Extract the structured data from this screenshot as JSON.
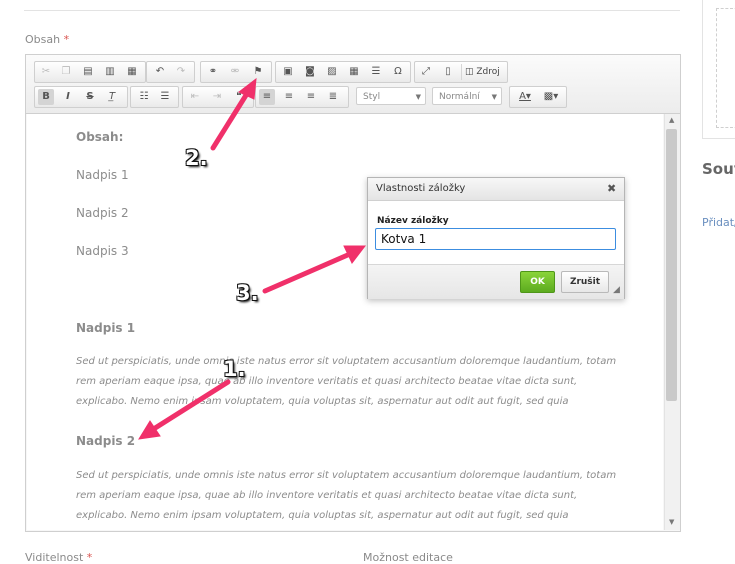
{
  "form": {
    "content_label": "Obsah",
    "required_mark": "*",
    "visibility_label": "Viditelnost",
    "editable_label": "Možnost editace"
  },
  "side": {
    "title": "Souv",
    "link": "Přidat/"
  },
  "toolbar": {
    "source_label": "Zdroj",
    "style_combo": "Styl",
    "format_combo": "Normální"
  },
  "content": {
    "toc_title": "Obsah:",
    "toc_items": [
      "Nadpis 1",
      "Nadpis 2",
      "Nadpis 3"
    ],
    "heading1": "Nadpis 1",
    "heading2": "Nadpis 2",
    "paragraph_line1": "Sed ut perspiciatis, unde omnis iste natus error sit voluptatem accusantium doloremque laudantium, totam",
    "paragraph_line2": "rem aperiam eaque ipsa, quae ab illo inventore veritatis et quasi architecto beatae vitae dicta sunt,",
    "paragraph_line3": "explicabo. Nemo enim ipsam voluptatem, quia voluptas sit, aspernatur aut odit aut fugit, sed quia"
  },
  "dialog": {
    "title": "Vlastnosti záložky",
    "close_glyph": "✖",
    "field_label": "Název záložky",
    "field_value": "Kotva 1",
    "ok_label": "OK",
    "cancel_label": "Zrušit"
  },
  "annotations": {
    "step1": "1.",
    "step2": "2.",
    "step3": "3."
  },
  "colors": {
    "arrow": "#f0306a",
    "ok_button": "#6cbf27",
    "input_focus": "#3c8de0"
  }
}
